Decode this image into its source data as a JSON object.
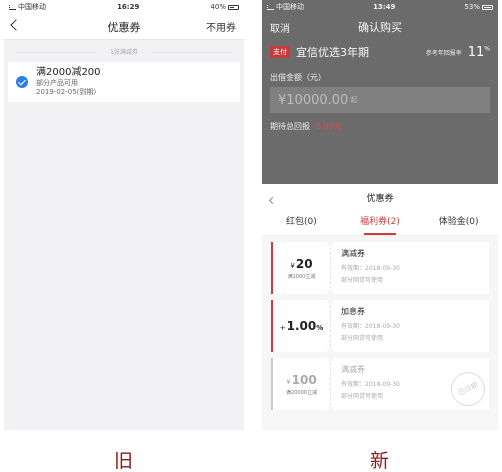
{
  "old_screen": {
    "status": {
      "carrier": "中国移动",
      "time": "16:29",
      "battery": "40%"
    },
    "nav": {
      "title": "优惠券",
      "right_action": "不用券"
    },
    "section_caption": "1张满减券",
    "coupon": {
      "title": "满2000减200",
      "scope": "部分产品可用",
      "expiry": "2019-02-05(到期)"
    },
    "caption": "旧"
  },
  "new_screen": {
    "status": {
      "carrier": "中国移动",
      "time": "13:49",
      "battery": "53%"
    },
    "nav": {
      "cancel": "取消",
      "title": "确认购买"
    },
    "product": {
      "pay_tag": "支付",
      "name": "宜信优选3年期",
      "rate_label": "参考年回报率",
      "rate_value": "11",
      "rate_unit": "%"
    },
    "amount_label": "出借金额（元）",
    "amount_placeholder": "¥10000.00",
    "amount_suffix": "起",
    "expect_label": "期待总回报",
    "expect_value": "0.00元",
    "sheet": {
      "title": "优惠券",
      "tabs": [
        {
          "label": "红包(0)"
        },
        {
          "label": "福利券(2)"
        },
        {
          "label": "体验金(0)"
        }
      ],
      "coupons": [
        {
          "currency": "¥",
          "amount": "20",
          "pct": "",
          "condition": "满1000立减",
          "title": "满减券",
          "date": "有效期：2018-09-30",
          "scope": "部分网贷可使用"
        },
        {
          "currency": "+",
          "amount": "1.00",
          "pct": "%",
          "condition": "",
          "title": "加息券",
          "date": "有效期：2018-09-30",
          "scope": "部分网贷可使用"
        },
        {
          "currency": "¥",
          "amount": "100",
          "pct": "",
          "condition": "满20000立减",
          "title": "满减券",
          "date": "有效期：2018-09-30",
          "scope": "部分网贷可使用",
          "stamp": "已过期"
        }
      ]
    },
    "caption": "新"
  },
  "colors": {
    "accent": "#d23a3a",
    "check": "#2b7de9",
    "caption": "#8f1a1a"
  },
  "icons": [
    "back-chevron-icon",
    "check-circle-icon",
    "signal-icon",
    "battery-icon"
  ]
}
